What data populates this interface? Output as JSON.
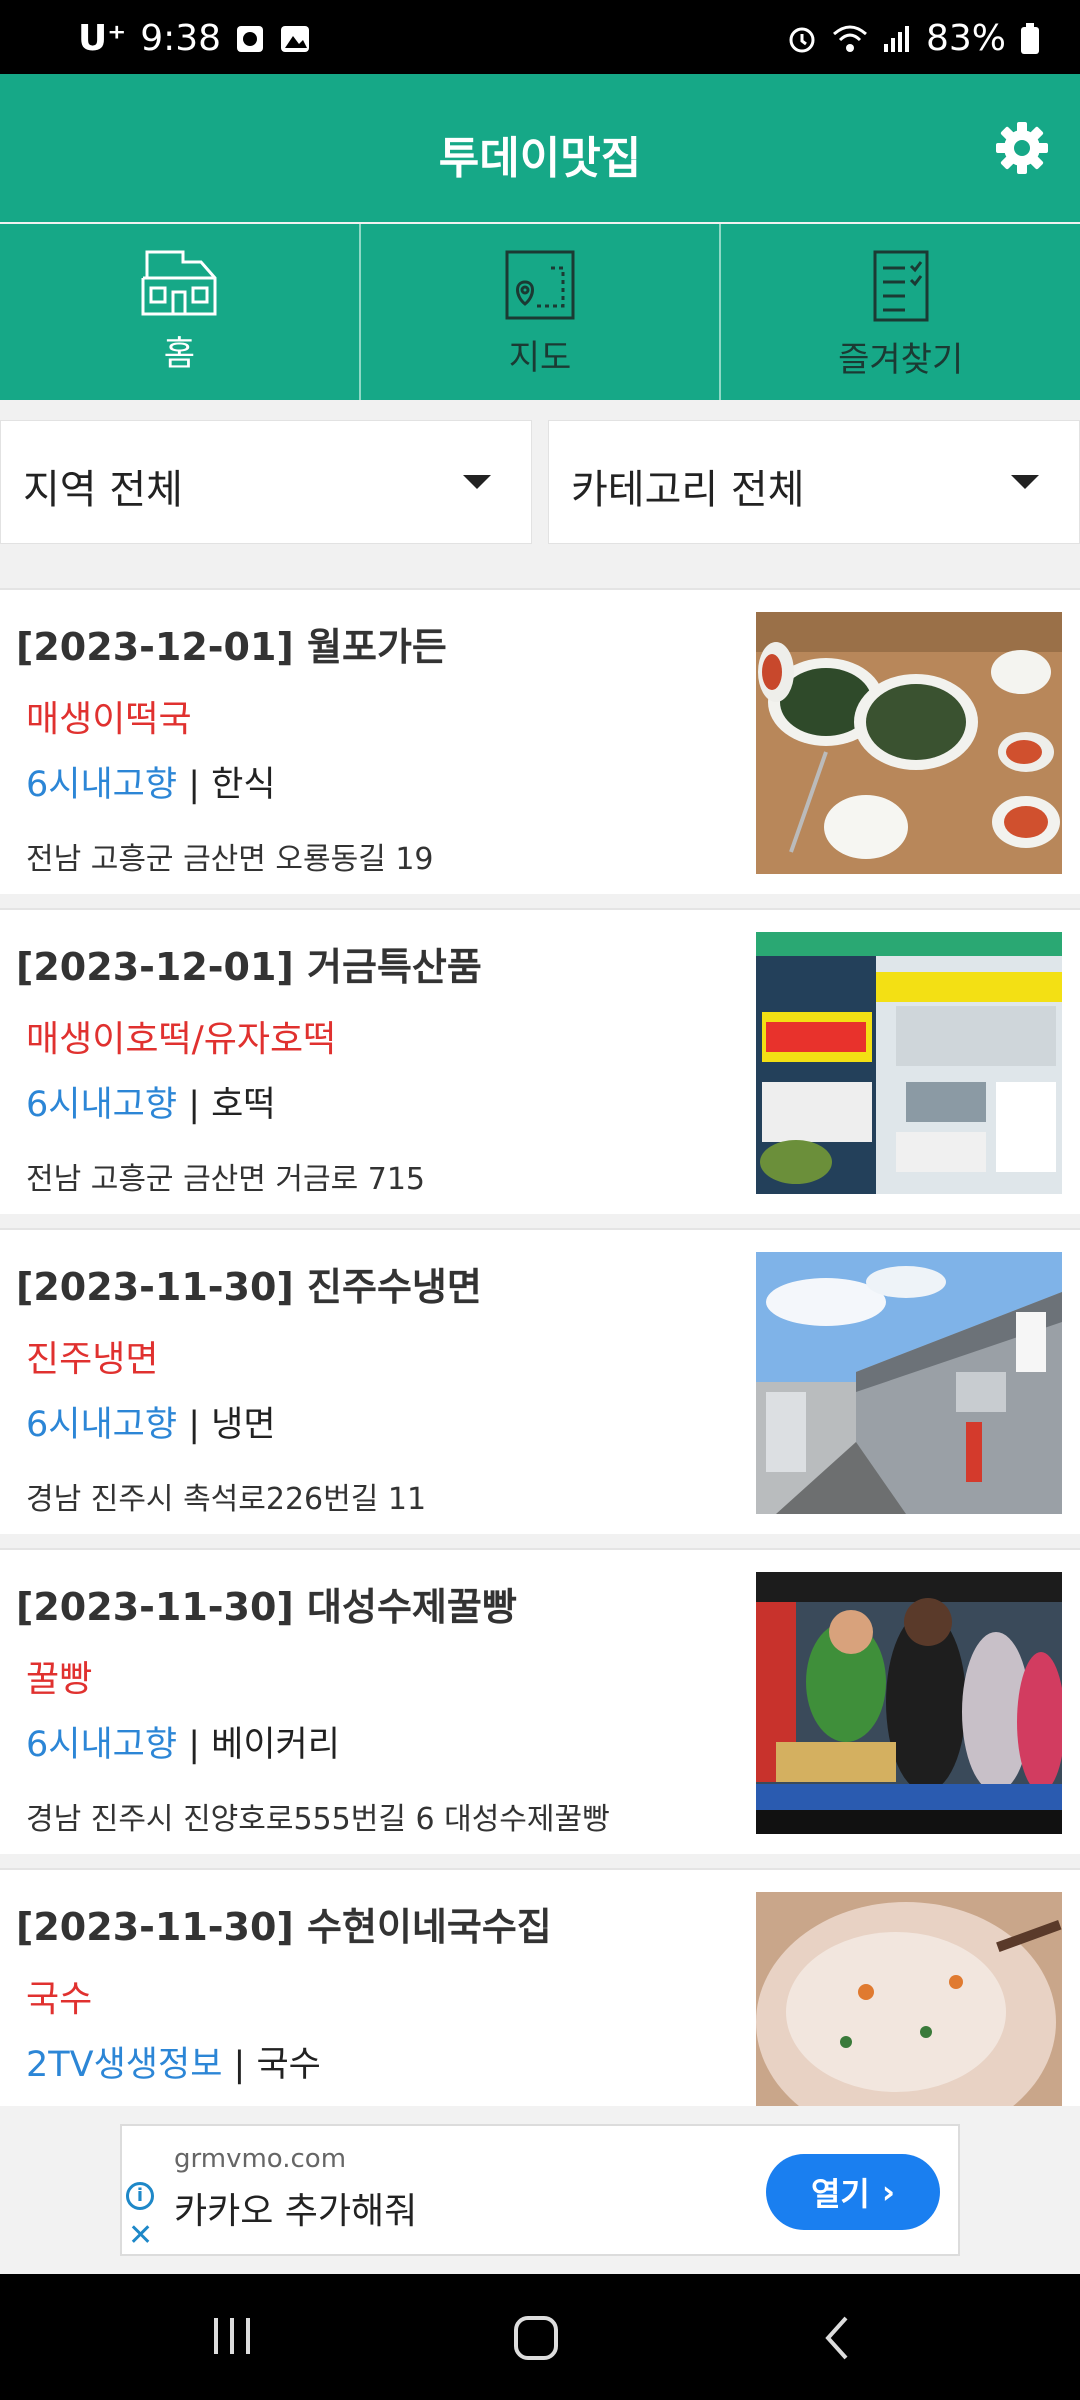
{
  "status_bar": {
    "carrier": "U⁺",
    "time": "9:38",
    "battery": "83%"
  },
  "app": {
    "title": "투데이맛집"
  },
  "tabs": [
    {
      "label": "홈",
      "icon": "home-icon",
      "active": true
    },
    {
      "label": "지도",
      "icon": "map-icon",
      "active": false
    },
    {
      "label": "즐겨찾기",
      "icon": "favorites-list-icon",
      "active": false
    }
  ],
  "filters": {
    "region": "지역 전체",
    "category": "카테고리 전체"
  },
  "restaurants": [
    {
      "title": "[2023-12-01] 월포가든",
      "dish": "매생이떡국",
      "program": "6시내고향",
      "category": "한식",
      "address": "전남 고흥군 금산면 오룡동길 19"
    },
    {
      "title": "[2023-12-01] 거금특산품",
      "dish": "매생이호떡/유자호떡",
      "program": "6시내고향",
      "category": "호떡",
      "address": "전남 고흥군 금산면 거금로 715"
    },
    {
      "title": "[2023-11-30] 진주수냉면",
      "dish": "진주냉면",
      "program": "6시내고향",
      "category": "냉면",
      "address": "경남 진주시 촉석로226번길 11"
    },
    {
      "title": "[2023-11-30] 대성수제꿀빵",
      "dish": "꿀빵",
      "program": "6시내고향",
      "category": "베이커리",
      "address": "경남 진주시 진양호로555번길 6 대성수제꿀빵"
    },
    {
      "title": "[2023-11-30] 수현이네국수집",
      "dish": "국수",
      "program": "2TV생생정보",
      "category": "국수",
      "address": ""
    }
  ],
  "ad": {
    "domain": "grmvmo.com",
    "text": "카카오 추가해줘",
    "button": "열기"
  },
  "colors": {
    "primary": "#16a887",
    "dish_red": "#e0312f",
    "program_blue": "#2c86d6",
    "ad_button": "#1a7ff0"
  }
}
